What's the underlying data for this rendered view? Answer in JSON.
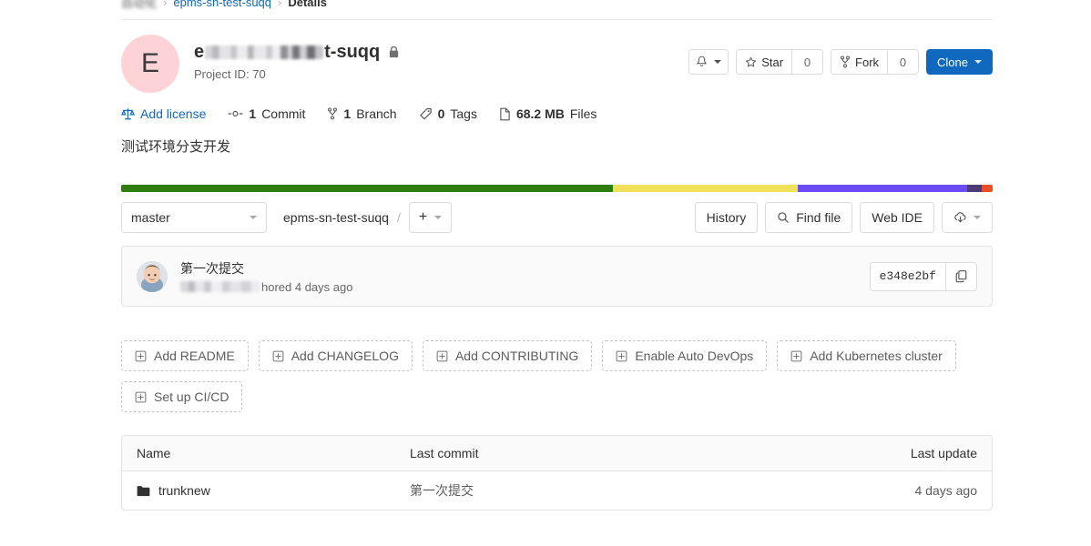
{
  "breadcrumb": {
    "group": "自动化",
    "project": "epms-sn-test-suqq",
    "current": "Details"
  },
  "project": {
    "avatar_initial": "E",
    "name_prefix": "e",
    "name_suffix": "t-suqq",
    "visibility_icon": "lock-icon",
    "project_id_label": "Project ID: 70",
    "description": "测试环境分支开发"
  },
  "actions": {
    "notify_icon": "bell-icon",
    "star_label": "Star",
    "star_count": "0",
    "fork_label": "Fork",
    "fork_count": "0",
    "clone_label": "Clone",
    "accent_color": "#1068bf"
  },
  "stats": {
    "license_label": "Add license",
    "commits": "1",
    "commits_unit": "Commit",
    "branches": "1",
    "branches_unit": "Branch",
    "tags": "0",
    "tags_unit": "Tags",
    "size": "68.2 MB",
    "size_unit": "Files"
  },
  "languages": [
    {
      "name": "segment-1",
      "color": "#2e7d0e",
      "percent": 56.4
    },
    {
      "name": "segment-2",
      "color": "#f1e05a",
      "percent": 21.2
    },
    {
      "name": "segment-3",
      "color": "#6b4df5",
      "percent": 19.5
    },
    {
      "name": "segment-4",
      "color": "#4b3b78",
      "percent": 1.6
    },
    {
      "name": "segment-5",
      "color": "#e84e28",
      "percent": 1.3
    }
  ],
  "repo_toolbar": {
    "branch": "master",
    "path_root": "epms-sn-test-suqq",
    "path_separator": "/",
    "add_glyph": "+",
    "history_label": "History",
    "find_file_label": "Find file",
    "web_ide_label": "Web IDE",
    "download_icon": "download-cloud-icon"
  },
  "commit": {
    "message": "第一次提交",
    "author_suffix": "hored 4 days ago",
    "sha": "e348e2bf",
    "copy_icon": "copy-icon"
  },
  "quick_actions": [
    {
      "label": "Add README",
      "icon": "plus-square-icon"
    },
    {
      "label": "Add CHANGELOG",
      "icon": "plus-square-icon"
    },
    {
      "label": "Add CONTRIBUTING",
      "icon": "plus-square-icon"
    },
    {
      "label": "Enable Auto DevOps",
      "icon": "plus-square-icon"
    },
    {
      "label": "Add Kubernetes cluster",
      "icon": "plus-square-icon"
    },
    {
      "label": "Set up CI/CD",
      "icon": "plus-square-icon"
    }
  ],
  "file_table": {
    "headers": {
      "name": "Name",
      "last_commit": "Last commit",
      "last_update": "Last update"
    },
    "rows": [
      {
        "name": "trunknew",
        "icon": "folder-icon",
        "last_commit": "第一次提交",
        "last_update": "4 days ago"
      }
    ]
  }
}
